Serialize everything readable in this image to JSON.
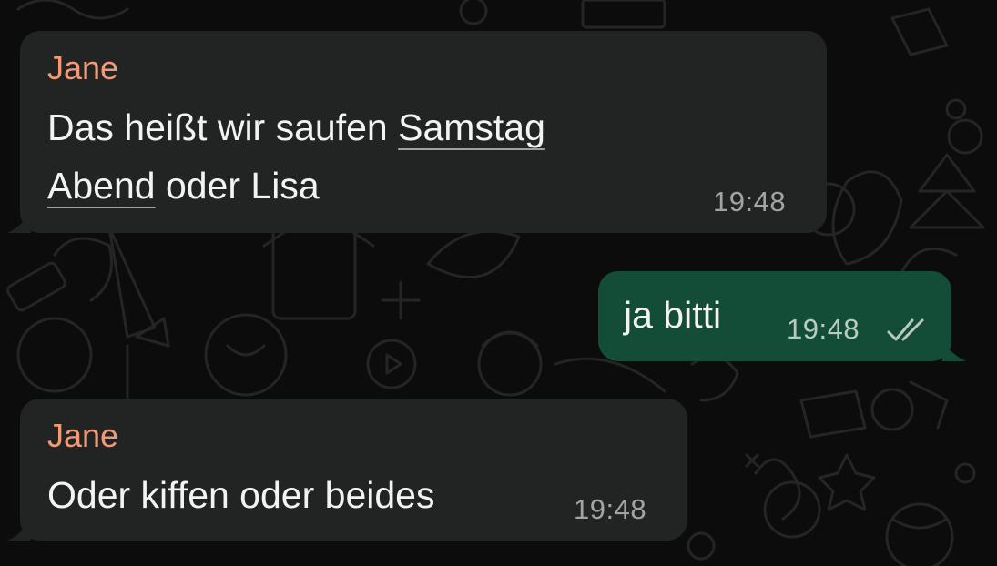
{
  "chat": {
    "messages": [
      {
        "direction": "incoming",
        "sender": "Jane",
        "text_part1": "Das heißt wir saufen ",
        "link_part1": "Samstag",
        "link_part2": "Abend",
        "text_part2": " oder Lisa",
        "time": "19:48"
      },
      {
        "direction": "outgoing",
        "text": "ja bitti",
        "time": "19:48",
        "status": "read",
        "status_icon": "double-check-icon"
      },
      {
        "direction": "incoming",
        "sender": "Jane",
        "text": "Oder kiffen oder beides",
        "time": "19:48"
      }
    ]
  },
  "colors": {
    "background": "#0b0c0b",
    "incoming_bubble": "#222423",
    "outgoing_bubble": "#134d37",
    "sender_name": "#f29a77",
    "message_text": "#f2f3f2",
    "timestamp": "#a0a5a2"
  }
}
